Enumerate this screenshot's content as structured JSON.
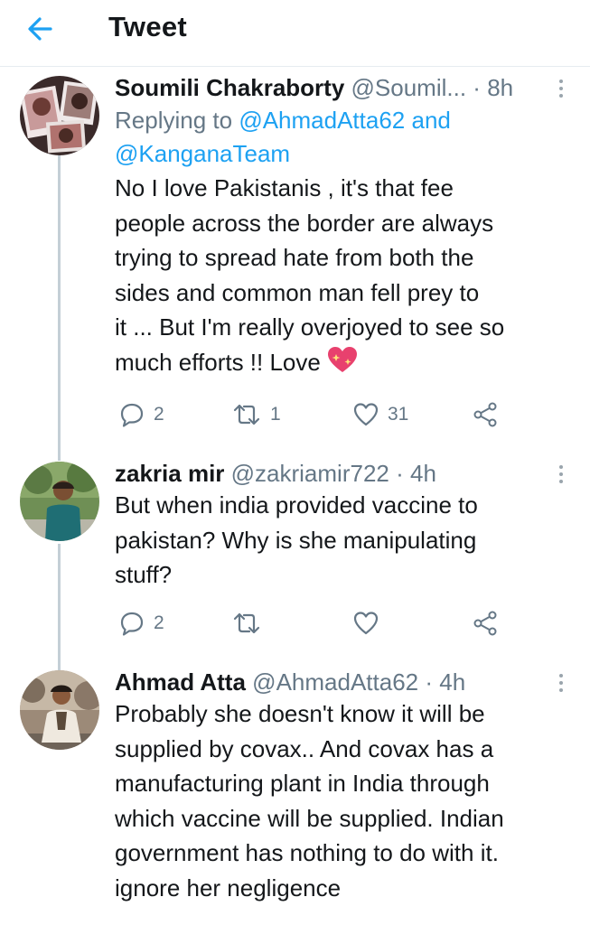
{
  "header": {
    "title": "Tweet",
    "back_icon": "arrow-left-icon"
  },
  "tweets": [
    {
      "name": "Soumili Chakraborty",
      "handle": "@Soumil...",
      "separator": "·",
      "time": "8h",
      "replying_prefix": "Replying to",
      "replying_mention1": "@AhmadAtta62",
      "replying_and": "and",
      "replying_mention2": "@KanganaTeam",
      "lines": [
        "No I love Pakistanis , it's that fee",
        "people across the border are always",
        "trying to spread hate from both the",
        "sides and common man fell prey to",
        "it ... But I'm really overjoyed to see so",
        "much efforts !! Love"
      ],
      "emoji": "sparkling-heart",
      "replies": "2",
      "retweets": "1",
      "likes": "31"
    },
    {
      "name": "zakria mir",
      "handle": "@zakriamir722",
      "separator": "·",
      "time": "4h",
      "lines": [
        "But when india provided vaccine to",
        "pakistan? Why is she manipulating",
        "stuff?"
      ],
      "replies": "2",
      "retweets": "",
      "likes": ""
    },
    {
      "name": "Ahmad Atta",
      "handle": "@AhmadAtta62",
      "separator": "·",
      "time": "4h",
      "lines": [
        "Probably she doesn't know it will be",
        "supplied by covax.. And covax has a",
        "manufacturing plant in India through",
        "which vaccine will be supplied. Indian",
        "government has nothing to do with it.",
        "ignore her negligence"
      ]
    }
  ],
  "colors": {
    "accent": "#1da1f2",
    "secondary_text": "#657786",
    "primary_text": "#14171a",
    "divider": "#e6ecf0"
  }
}
